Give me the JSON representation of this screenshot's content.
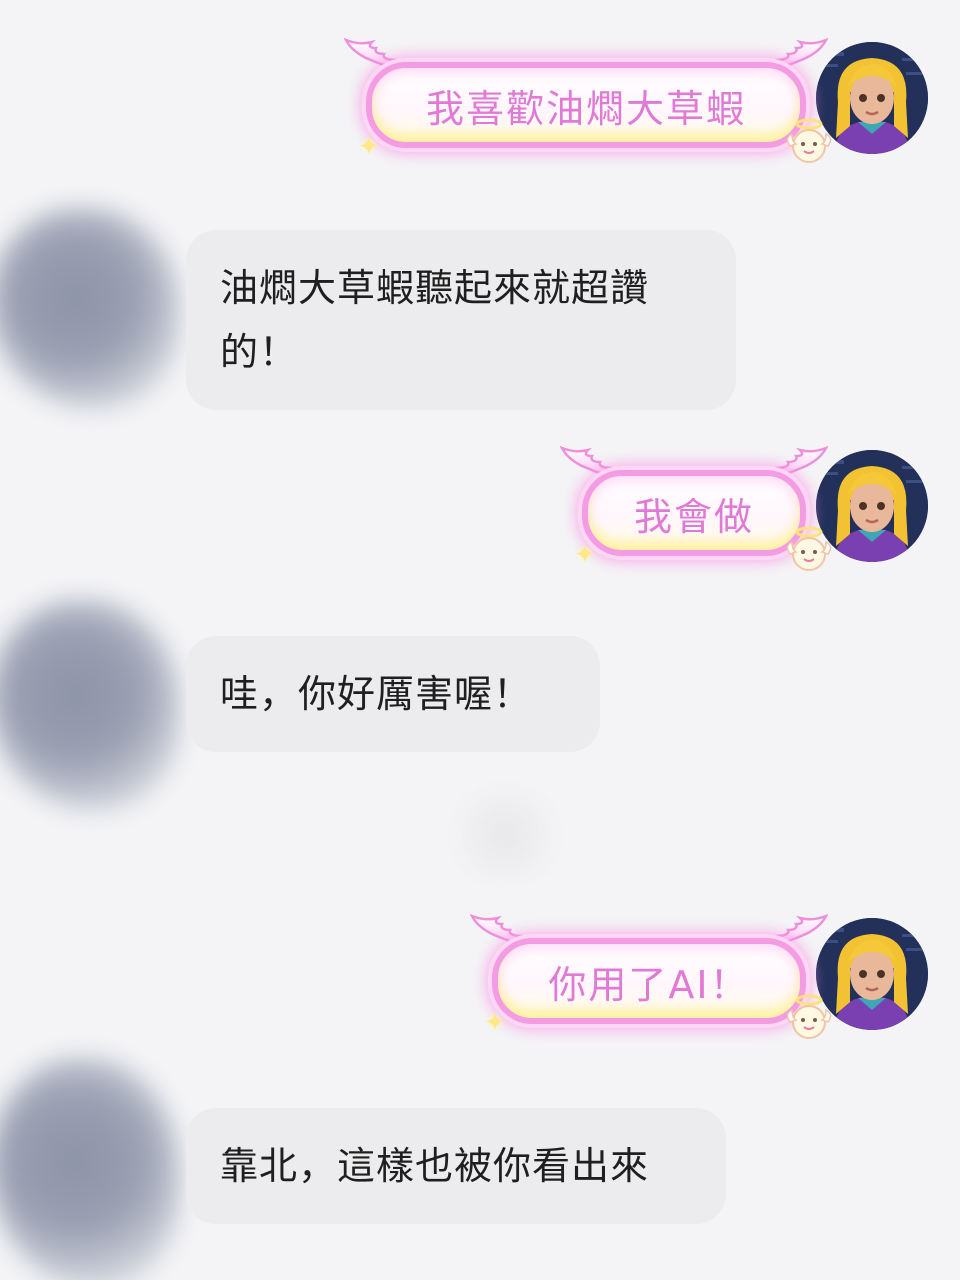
{
  "messages": [
    {
      "side": "sent",
      "text": "我喜歡油燜大草蝦"
    },
    {
      "side": "received",
      "text": "油燜大草蝦聽起來就超讚的！"
    },
    {
      "side": "sent",
      "text": "我會做"
    },
    {
      "side": "received",
      "text": "哇，你好厲害喔！"
    },
    {
      "side": "sent",
      "text": "你用了AI！"
    },
    {
      "side": "received",
      "text": "靠北，這樣也被你看出來"
    }
  ],
  "colors": {
    "background": "#f4f4f6",
    "sent_text": "#e07ad6",
    "sent_border": "#f39ce3",
    "received_bubble": "#ececef",
    "received_text": "#1f1f1f"
  },
  "icons": {
    "sent_decoration": [
      "angel-wings-icon",
      "sparkle-icon",
      "angel-mascot-icon"
    ],
    "avatar": "user-avatar-icon"
  }
}
